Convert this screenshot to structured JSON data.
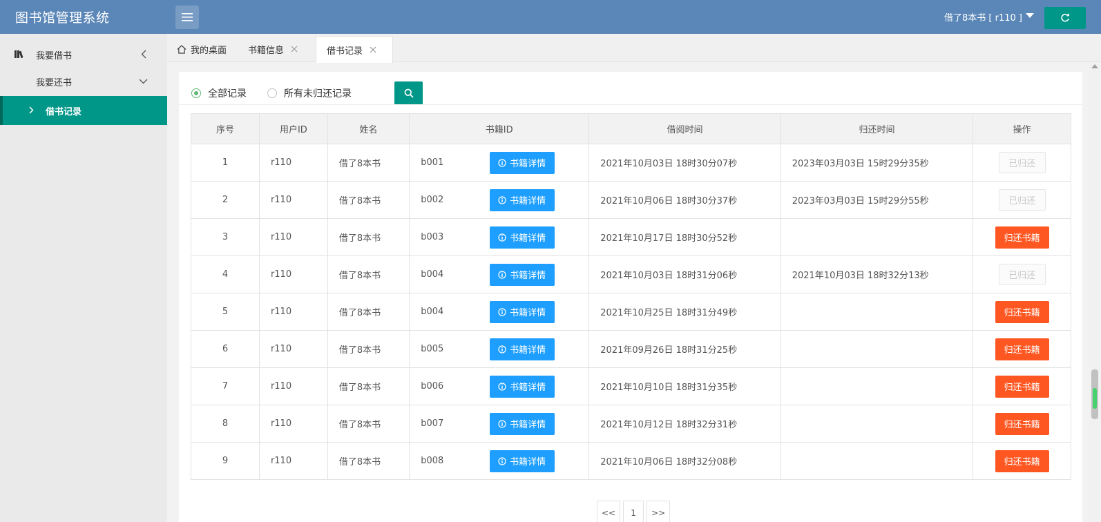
{
  "app": {
    "title": "图书馆管理系统"
  },
  "header": {
    "user_label": "借了8本书 [ r110 ]"
  },
  "sidebar": {
    "items": [
      {
        "label": "我要借书"
      },
      {
        "label": "我要还书"
      },
      {
        "label": "借书记录"
      }
    ]
  },
  "tabs": [
    {
      "label": "我的桌面"
    },
    {
      "label": "书籍信息"
    },
    {
      "label": "借书记录"
    }
  ],
  "filters": {
    "all_label": "全部记录",
    "unreturned_label": "所有未归还记录"
  },
  "table": {
    "headers": [
      "序号",
      "用户ID",
      "姓名",
      "书籍ID",
      "借阅时间",
      "归还时间",
      "操作"
    ],
    "detail_label": "书籍详情",
    "returned_label": "已归还",
    "return_label": "归还书籍",
    "rows": [
      {
        "no": "1",
        "user_id": "r110",
        "name": "借了8本书",
        "book_id": "b001",
        "borrow_time": "2021年10月03日 18时30分07秒",
        "return_time": "2023年03月03日 15时29分35秒",
        "returned": true
      },
      {
        "no": "2",
        "user_id": "r110",
        "name": "借了8本书",
        "book_id": "b002",
        "borrow_time": "2021年10月06日 18时30分37秒",
        "return_time": "2023年03月03日 15时29分55秒",
        "returned": true
      },
      {
        "no": "3",
        "user_id": "r110",
        "name": "借了8本书",
        "book_id": "b003",
        "borrow_time": "2021年10月17日 18时30分52秒",
        "return_time": "",
        "returned": false
      },
      {
        "no": "4",
        "user_id": "r110",
        "name": "借了8本书",
        "book_id": "b004",
        "borrow_time": "2021年10月03日 18时31分06秒",
        "return_time": "2021年10月03日 18时32分13秒",
        "returned": true
      },
      {
        "no": "5",
        "user_id": "r110",
        "name": "借了8本书",
        "book_id": "b004",
        "borrow_time": "2021年10月25日 18时31分49秒",
        "return_time": "",
        "returned": false
      },
      {
        "no": "6",
        "user_id": "r110",
        "name": "借了8本书",
        "book_id": "b005",
        "borrow_time": "2021年09月26日 18时31分25秒",
        "return_time": "",
        "returned": false
      },
      {
        "no": "7",
        "user_id": "r110",
        "name": "借了8本书",
        "book_id": "b006",
        "borrow_time": "2021年10月10日 18时31分35秒",
        "return_time": "",
        "returned": false
      },
      {
        "no": "8",
        "user_id": "r110",
        "name": "借了8本书",
        "book_id": "b007",
        "borrow_time": "2021年10月12日 18时32分31秒",
        "return_time": "",
        "returned": false
      },
      {
        "no": "9",
        "user_id": "r110",
        "name": "借了8本书",
        "book_id": "b008",
        "borrow_time": "2021年10月06日 18时32分08秒",
        "return_time": "",
        "returned": false
      }
    ]
  },
  "pagination": {
    "prev": "<<",
    "current": "1",
    "next": ">>"
  },
  "colors": {
    "header": "#5b87b8",
    "primary": "#009688",
    "info": "#1e9fff",
    "danger": "#ff5722"
  }
}
